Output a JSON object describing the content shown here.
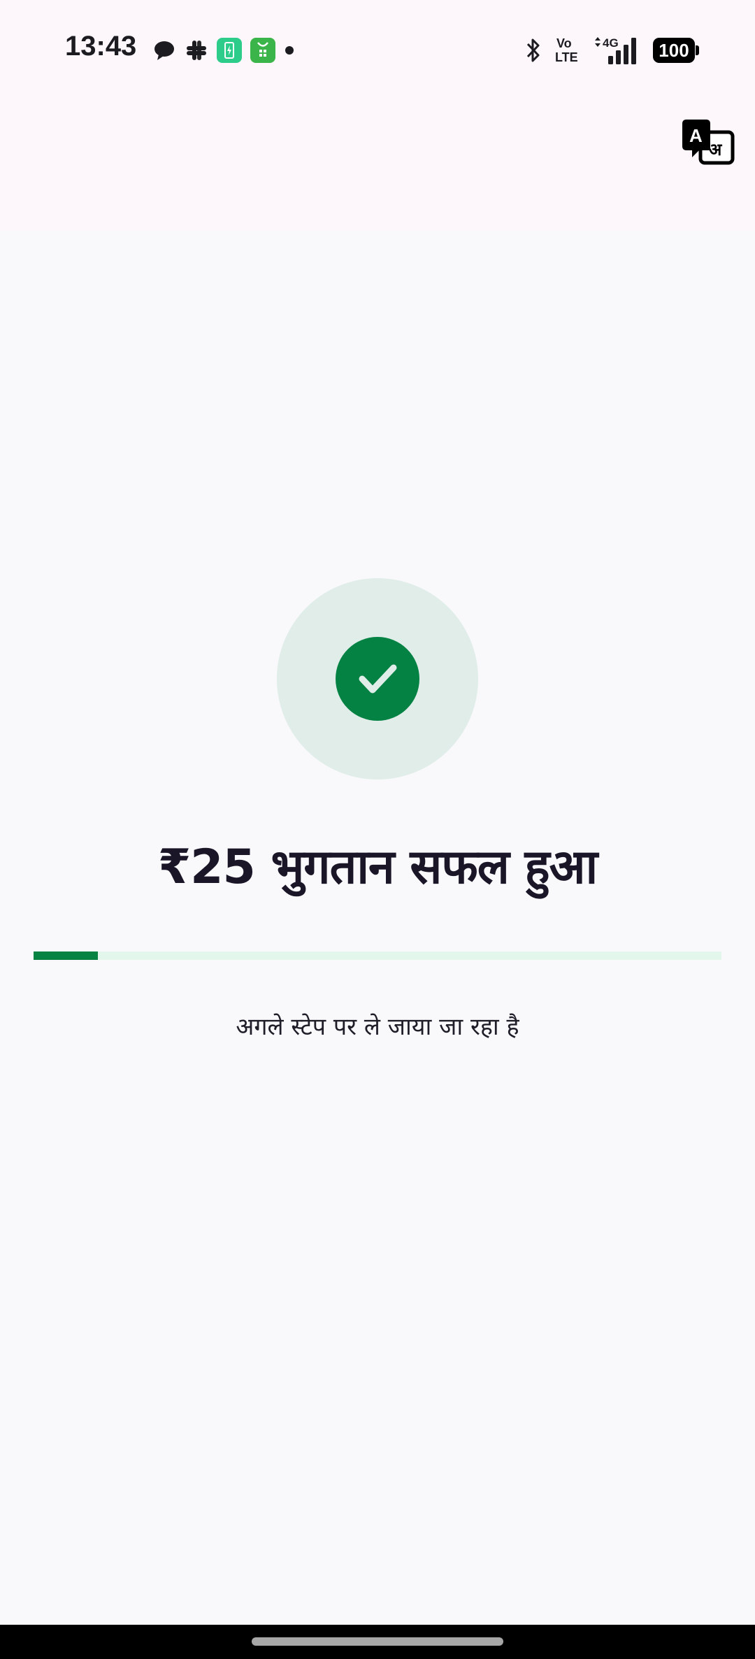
{
  "status_bar": {
    "time": "13:43",
    "network": "4G",
    "volte_top": "Vo",
    "volte_bottom": "LTE",
    "battery": "100",
    "notification_icons": [
      "chat-bubble-icon",
      "slack-icon",
      "battery-app-icon",
      "shopping-bag-icon",
      "more-dot-icon"
    ]
  },
  "header": {
    "translate_icon": "translate-icon",
    "translate_latin": "A",
    "translate_hindi": "अ"
  },
  "payment": {
    "title": "₹25 भुगतान सफल हुआ",
    "progress_fraction": 0.0935,
    "subtitle": "अगले स्टेप पर ले जाया जा रहा है"
  },
  "colors": {
    "accent_green": "#068243",
    "success_circle_bg": "#e0ede9",
    "progress_track": "#e3f6ec",
    "header_bg": "#fdf7fc",
    "page_bg": "#f9f9fb"
  }
}
